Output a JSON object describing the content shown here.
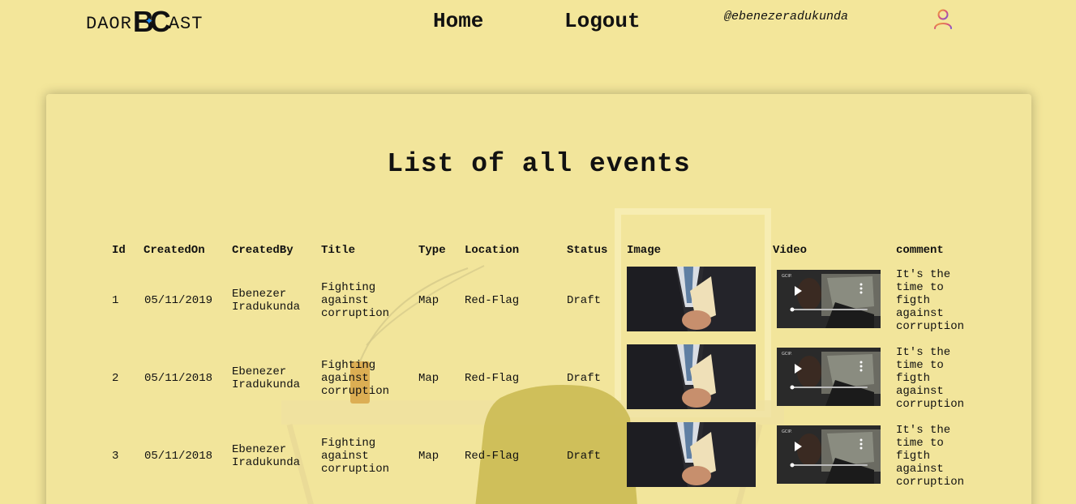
{
  "brand": {
    "left": "DAOR",
    "mark": "BC",
    "right": "AST"
  },
  "nav": {
    "home": "Home",
    "logout": "Logout"
  },
  "user": {
    "handle": "@ebenezeradukunda",
    "icon": "user-icon"
  },
  "page": {
    "title": "List of all events"
  },
  "table": {
    "headers": [
      "Id",
      "CreatedOn",
      "CreatedBy",
      "Title",
      "Type",
      "Location",
      "Status",
      "Image",
      "Video",
      "comment"
    ],
    "rows": [
      {
        "id": "1",
        "created_on": "05/11/2019",
        "created_by": "Ebenezer Iradukunda",
        "title": "Fighting against corruption",
        "type": "Map",
        "location": "Red-Flag",
        "status": "Draft",
        "comment": "It's the time to figth against corruption"
      },
      {
        "id": "2",
        "created_on": "05/11/2018",
        "created_by": "Ebenezer Iradukunda",
        "title": "Fighting against corruption",
        "type": "Map",
        "location": "Red-Flag",
        "status": "Draft",
        "comment": "It's the time to figth against corruption"
      },
      {
        "id": "3",
        "created_on": "05/11/2018",
        "created_by": "Ebenezer Iradukunda",
        "title": "Fighting against corruption",
        "type": "Map",
        "location": "Red-Flag",
        "status": "Draft",
        "comment": "It's the time to figth against corruption"
      }
    ]
  },
  "icons": {
    "play": "play-icon",
    "more": "more-vertical-icon"
  },
  "colors": {
    "background": "#f3e69a",
    "accent": "#1e90ff",
    "text": "#111111"
  }
}
